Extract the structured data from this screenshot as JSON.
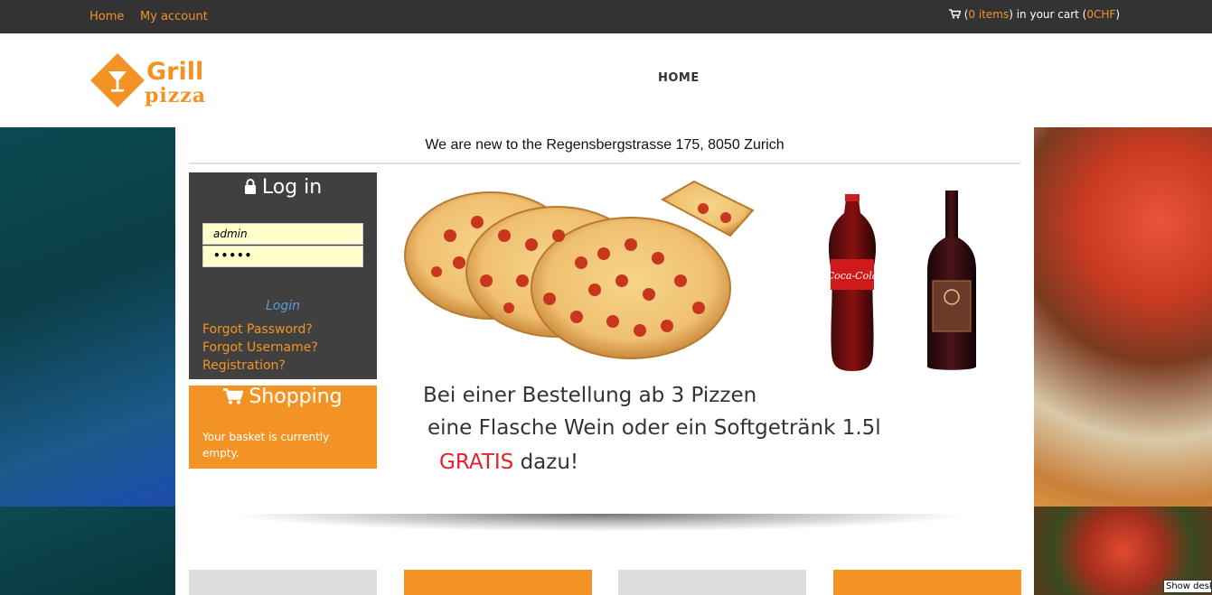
{
  "topbar": {
    "home_label": "Home",
    "account_label": "My account",
    "cart": {
      "open_paren": "(",
      "items": "0 items",
      "middle": ") in your cart (",
      "total": "0CHF",
      "close_paren": ")"
    }
  },
  "header": {
    "logo": {
      "word1": "Grill",
      "word2": "pizza"
    },
    "nav": [
      {
        "label": "HOME"
      }
    ]
  },
  "notice": "We are new to the Regensbergstrasse 175, 8050 Zurich",
  "login": {
    "title": "Log in",
    "username_value": "admin",
    "password_value": "•••••",
    "button_label": "Login",
    "links": [
      "Forgot Password?",
      "Forgot Username?",
      "Registration?"
    ]
  },
  "shopping": {
    "title": "Shopping",
    "text": "Your basket is currently empty."
  },
  "promo": {
    "line1": "Bei einer Bestellung ab 3 Pizzen",
    "line2": "eine Flasche Wein oder ein Softgetränk 1.5l",
    "gratis": "GRATIS",
    "tail": "dazu!",
    "coke_brand": "Coca-Cola"
  },
  "tiles": [
    {
      "color": "#dddddd"
    },
    {
      "color": "#f39325"
    },
    {
      "color": "#dddddd"
    },
    {
      "color": "#f39325"
    }
  ],
  "show_desktop": "Show desktop",
  "colors": {
    "accent": "#f39325",
    "topbar": "#333333",
    "login_bg": "#404040",
    "input_bg": "#ffffcc",
    "link_blue": "#5b9bd5",
    "promo_red": "#e2212c"
  }
}
